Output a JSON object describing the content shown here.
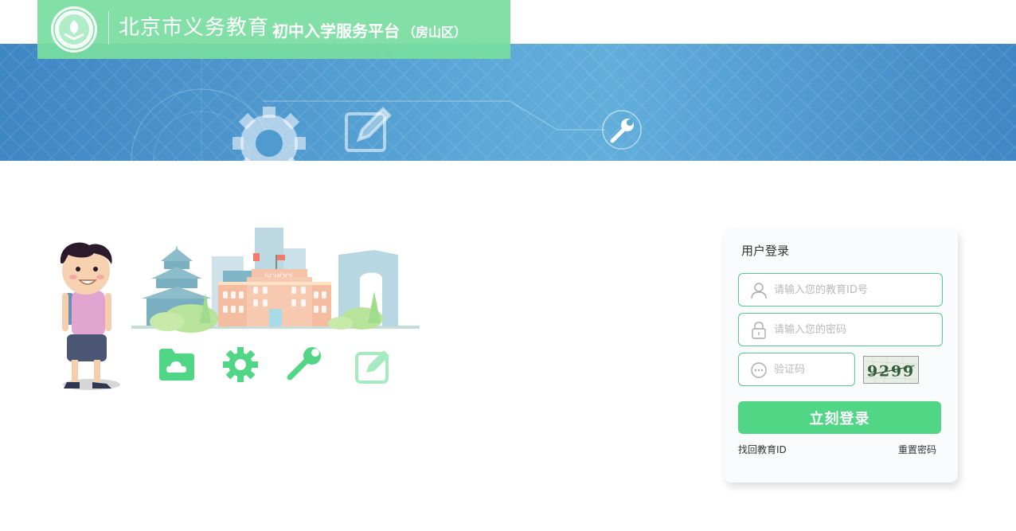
{
  "header": {
    "title_main": "北京市义务教育",
    "title_sub": "初中入学服务平台",
    "district": "（房山区）",
    "accent_color": "#78dea0",
    "banner_color": "#4b96cd"
  },
  "illustration": {
    "school_sign": "SCHOOL",
    "icons": [
      "folder-cloud-icon",
      "gear-icon",
      "wrench-icon",
      "edit-icon"
    ]
  },
  "login": {
    "title": "用户登录",
    "username_placeholder": "请输入您的教育ID号",
    "password_placeholder": "请输入您的密码",
    "captcha_placeholder": "验证码",
    "captcha_text": "9299",
    "submit_label": "立刻登录",
    "forgot_id_link": "找回教育ID",
    "reset_password_link": "重置密码",
    "button_color": "#50d684"
  }
}
